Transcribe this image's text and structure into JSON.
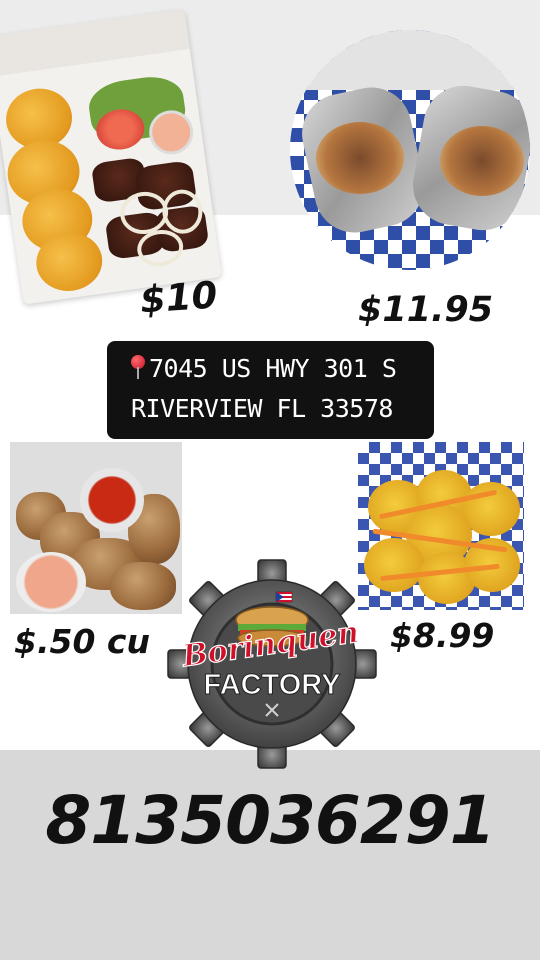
{
  "menu_items": [
    {
      "name": "plantains-steak-plate",
      "price": "$10"
    },
    {
      "name": "sandwich",
      "price": "$11.95"
    },
    {
      "name": "wings",
      "price": "$.50 cu"
    },
    {
      "name": "tostones",
      "price": "$8.99"
    }
  ],
  "address": {
    "line1": "7045 US HWY 301 S",
    "line2": "RIVERVIEW FL 33578",
    "icon": "map-pin-icon"
  },
  "logo": {
    "name_line1": "Borinquen",
    "name_line2": "FACTORY",
    "icon": "gear-sandwich-logo"
  },
  "phone": "8135036291",
  "colors": {
    "background": "#ffffff",
    "address_box": "#111111",
    "checker_blue": "#2e4ea8",
    "logo_red": "#d0102a",
    "logo_gear": "#5a5a5a"
  }
}
